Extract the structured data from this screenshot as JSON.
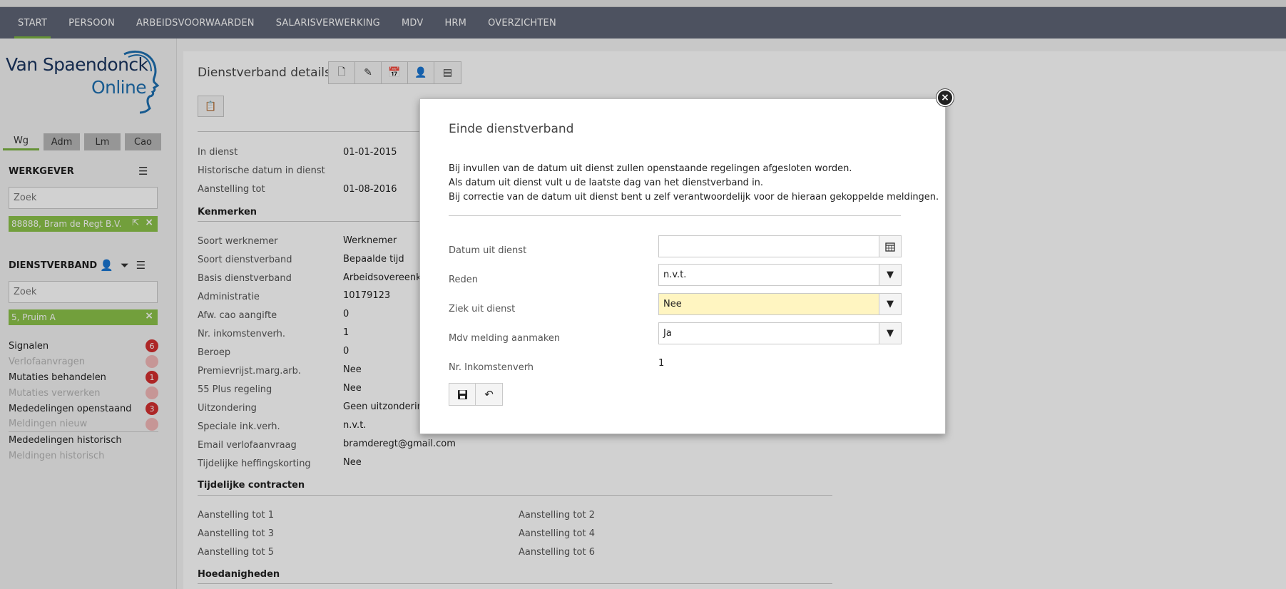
{
  "nav": {
    "items": [
      {
        "label": "START",
        "active": true
      },
      {
        "label": "PERSOON",
        "active": false
      },
      {
        "label": "ARBEIDSVOORWAARDEN",
        "active": false
      },
      {
        "label": "SALARISVERWERKING",
        "active": false
      },
      {
        "label": "MDV",
        "active": false
      },
      {
        "label": "HRM",
        "active": false
      },
      {
        "label": "OVERZICHTEN",
        "active": false
      }
    ]
  },
  "sidebar": {
    "logo": {
      "line1": "Van Spaendonck",
      "line2": "Online"
    },
    "tabs": [
      "Wg",
      "Adm",
      "Lm",
      "Cao"
    ],
    "werkgever": {
      "title": "WERKGEVER",
      "search_placeholder": "Zoek",
      "selected": "88888, Bram de Regt B.V."
    },
    "dienstverband": {
      "title": "DIENSTVERBAND",
      "search_placeholder": "Zoek",
      "selected": "5, Pruim A"
    },
    "list": [
      {
        "label": "Signalen",
        "count": "6",
        "dim": false
      },
      {
        "label": "Verlofaanvragen",
        "count": "0",
        "dim": true
      },
      {
        "label": "Mutaties behandelen",
        "count": "1",
        "dim": false
      },
      {
        "label": "Mutaties verwerken",
        "count": "0",
        "dim": true
      },
      {
        "label": "Mededelingen openstaand",
        "count": "3",
        "dim": false
      },
      {
        "label": "Meldingen nieuw",
        "count": "0",
        "dim": true
      },
      {
        "label": "Mededelingen historisch",
        "count": "",
        "dim": false
      },
      {
        "label": "Meldingen historisch",
        "count": "",
        "dim": true
      }
    ]
  },
  "main": {
    "title": "Dienstverband details",
    "fields_top": [
      {
        "label": "In dienst",
        "value": "01-01-2015"
      },
      {
        "label": "Historische datum in dienst",
        "value": ""
      },
      {
        "label": "Aanstelling tot",
        "value": "01-08-2016"
      }
    ],
    "kenmerken_title": "Kenmerken",
    "kenmerken": [
      {
        "label": "Soort werknemer",
        "value": "Werknemer"
      },
      {
        "label": "Soort dienstverband",
        "value": "Bepaalde tijd"
      },
      {
        "label": "Basis dienstverband",
        "value": "Arbeidsovereenko"
      },
      {
        "label": "Administratie",
        "value": "10179123"
      },
      {
        "label": "Afw. cao aangifte",
        "value": "0"
      },
      {
        "label": "Nr. inkomstenverh.",
        "value": "1"
      },
      {
        "label": "Beroep",
        "value": "0"
      },
      {
        "label": "Premievrijst.marg.arb.",
        "value": "Nee"
      },
      {
        "label": "55 Plus regeling",
        "value": "Nee"
      },
      {
        "label": "Uitzondering",
        "value": "Geen uitzondering"
      },
      {
        "label": "Speciale ink.verh.",
        "value": "n.v.t."
      },
      {
        "label": "Email verlofaanvraag",
        "value": "bramderegt@gmail.com"
      },
      {
        "label": "Tijdelijke heffingskorting",
        "value": "Nee"
      }
    ],
    "tijdelijke_title": "Tijdelijke contracten",
    "tijdelijke": [
      "Aanstelling tot 1",
      "Aanstelling tot 2",
      "Aanstelling tot 3",
      "Aanstelling tot 4",
      "Aanstelling tot 5",
      "Aanstelling tot 6"
    ],
    "hoedanigheden_title": "Hoedanigheden"
  },
  "modal": {
    "title": "Einde dienstverband",
    "text": [
      "Bij invullen van de datum uit dienst zullen openstaande regelingen afgesloten worden.",
      "Als datum uit dienst vult u de laatste dag van het dienstverband in.",
      "Bij correctie van de datum uit dienst bent u zelf verantwoordelijk voor de hieraan gekoppelde meldingen."
    ],
    "fields": {
      "datum_label": "Datum uit dienst",
      "datum_value": "",
      "reden_label": "Reden",
      "reden_value": "n.v.t.",
      "ziek_label": "Ziek uit dienst",
      "ziek_value": "Nee",
      "mdv_label": "Mdv melding aanmaken",
      "mdv_value": "Ja",
      "nr_label": "Nr. Inkomstenverh",
      "nr_value": "1"
    }
  },
  "colors": {
    "navbar": "#5e6476",
    "accent": "#7cb342",
    "badge": "#d32f2f",
    "highlight": "#fff5c1"
  }
}
